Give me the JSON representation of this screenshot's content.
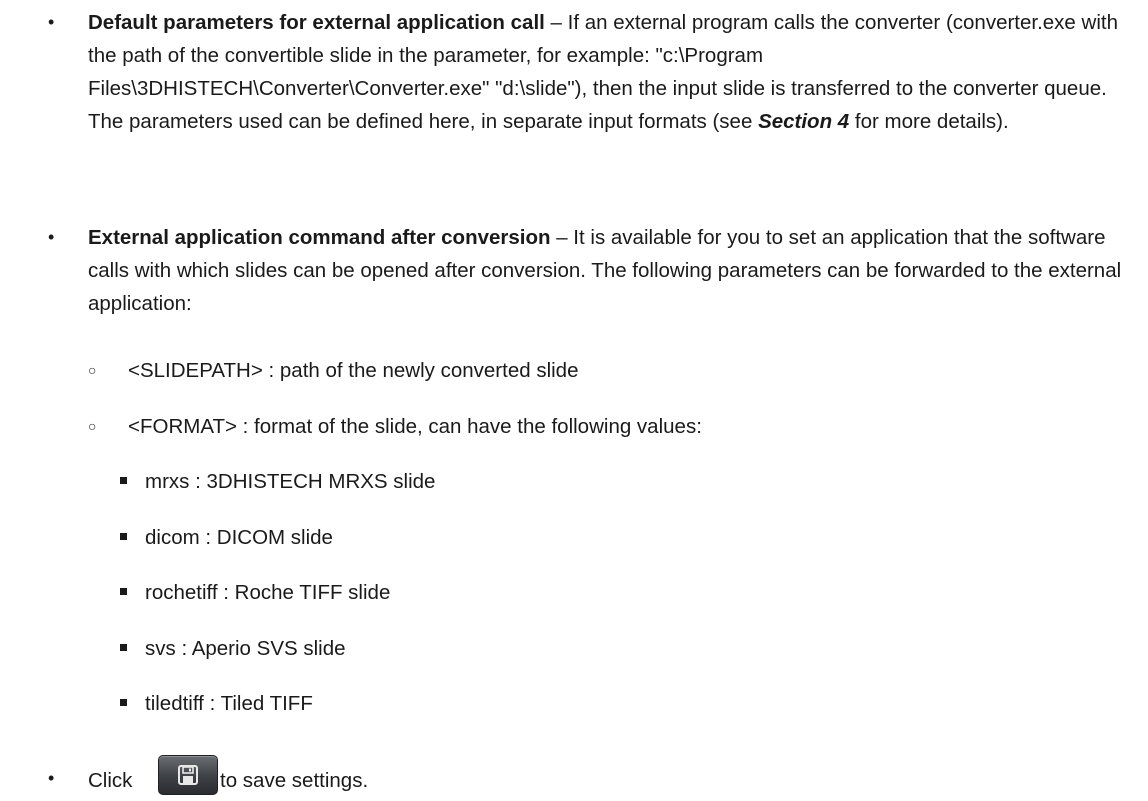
{
  "items": [
    {
      "bold": "Default parameters for external application call",
      "text_before_section": " – If an external program calls the converter (converter.exe with the path of the convertible slide in the parameter, for example: \"c:\\Program Files\\3DHISTECH\\Converter\\Converter.exe\" \"d:\\slide\"), then the input slide is transferred to the converter queue. The parameters used can be defined here, in separate input formats (see ",
      "section_ref": "Section 4",
      "text_after_section": " for more details)."
    },
    {
      "bold": "External application command after conversion",
      "text": " – It is available for you to set an application that the software calls with which slides can be opened after conversion. The following parameters can be forwarded to the external application:"
    }
  ],
  "params": [
    "<SLIDEPATH> : path of the newly converted slide",
    "<FORMAT> : format of the slide, can have the following values:"
  ],
  "formats": [
    "mrxs : 3DHISTECH MRXS slide",
    "dicom : DICOM slide",
    "rochetiff : Roche TIFF slide",
    "svs : Aperio SVS slide",
    "tiledtiff : Tiled TIFF"
  ],
  "save": {
    "click_label": "Click",
    "after_label": "to save settings.",
    "icon": "floppy-disk-icon"
  }
}
